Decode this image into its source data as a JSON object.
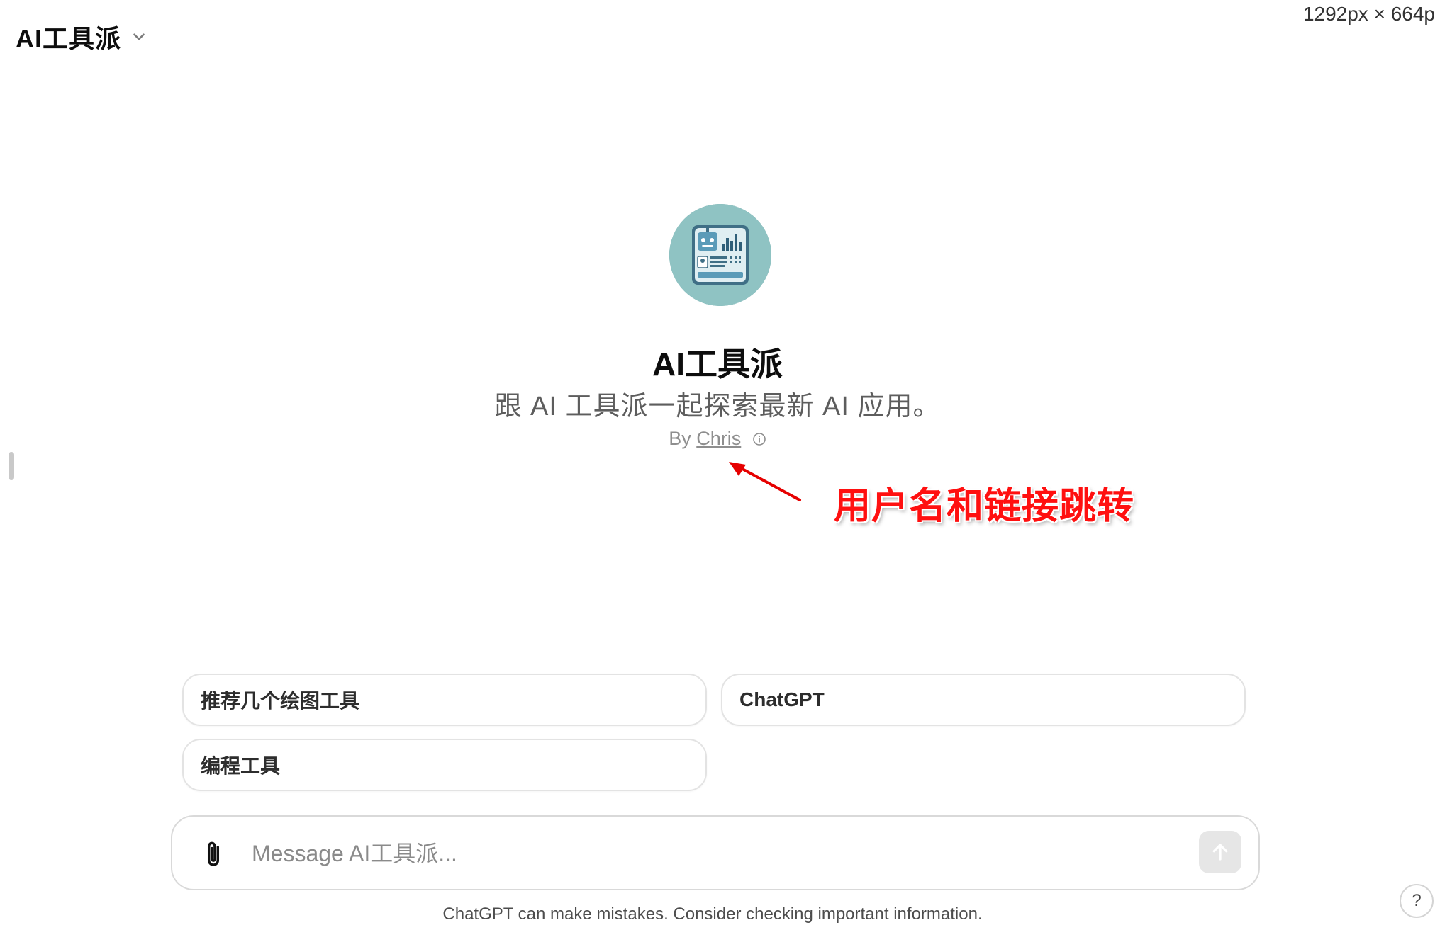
{
  "header": {
    "gpt_title": "AI工具派"
  },
  "viewport_readout": "1292px × 664px",
  "profile": {
    "name": "AI工具派",
    "description": "跟 AI 工具派一起探索最新 AI 应用。",
    "by_prefix": "By",
    "author": "Chris"
  },
  "annotation": {
    "text": "用户名和链接跳转",
    "color": "#ff1010"
  },
  "suggestions": [
    {
      "label": "推荐几个绘图工具"
    },
    {
      "label": "ChatGPT"
    },
    {
      "label": "编程工具"
    }
  ],
  "composer": {
    "placeholder": "Message AI工具派...",
    "value": ""
  },
  "footer": {
    "disclaimer": "ChatGPT can make mistakes. Consider checking important information.",
    "help_label": "?"
  },
  "icons": {
    "title_chevron": "chevron-down-icon",
    "info": "info-icon",
    "attach": "paperclip-icon",
    "send": "arrow-up-icon"
  }
}
